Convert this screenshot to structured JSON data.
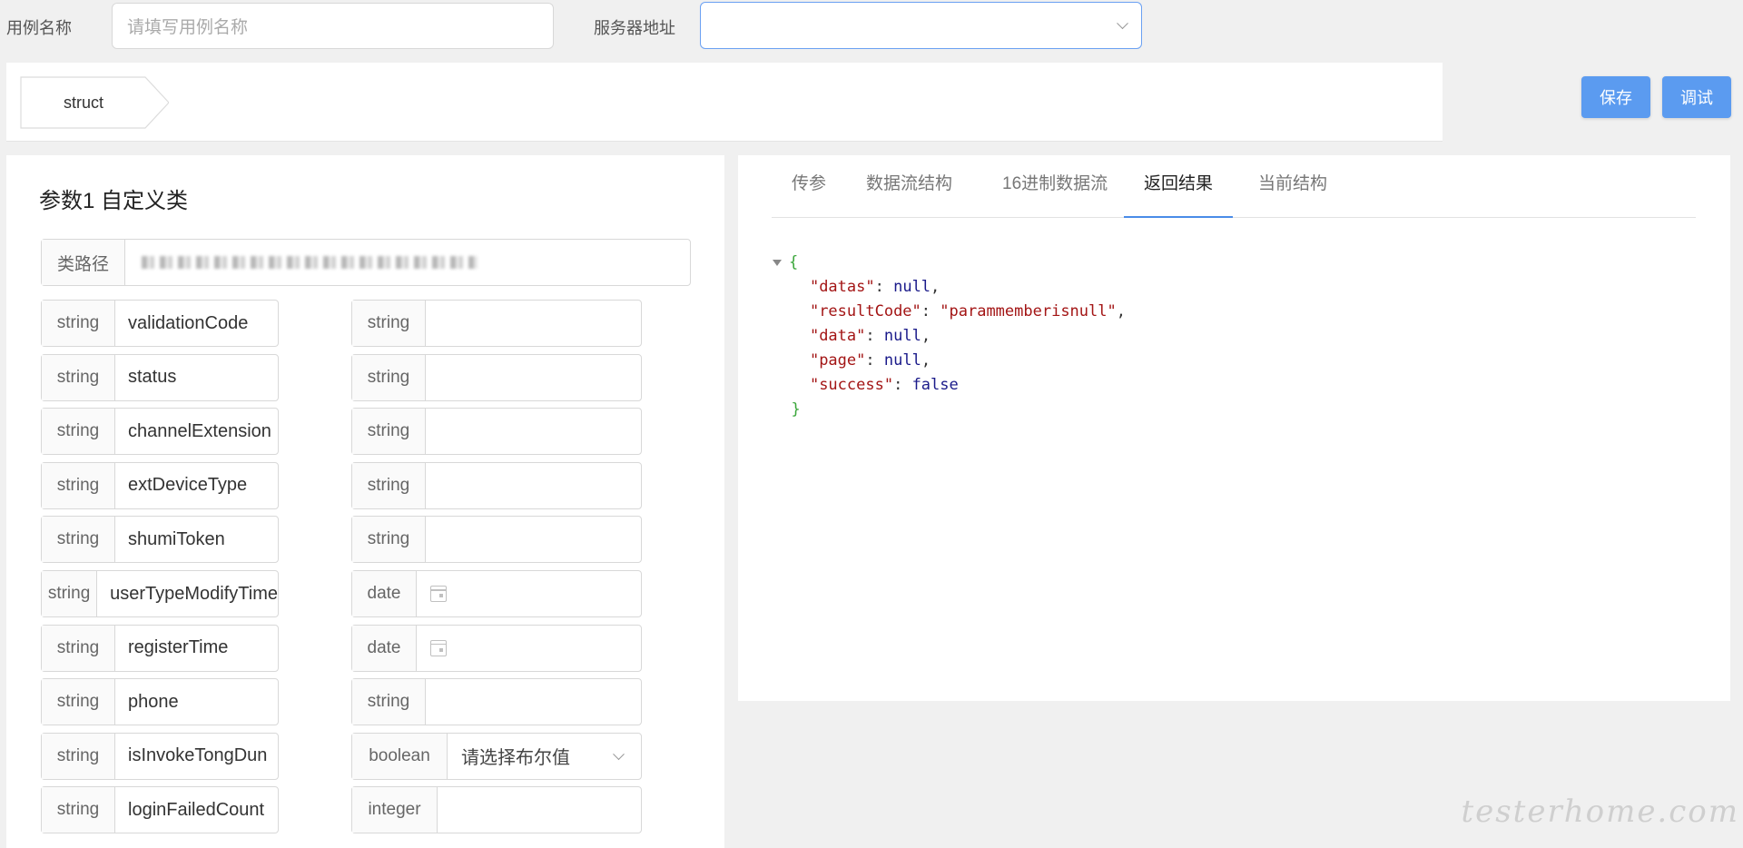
{
  "top": {
    "case_name_label": "用例名称",
    "case_name_placeholder": "请填写用例名称",
    "server_label": "服务器地址",
    "server_value": ""
  },
  "struct_tag": "struct",
  "buttons": {
    "save": "保存",
    "debug": "调试"
  },
  "left": {
    "title": "参数1 自定义类",
    "class_path_label": "类路径",
    "rows": [
      {
        "type": "string",
        "name": "validationCode",
        "val_type": "string",
        "kind": "text"
      },
      {
        "type": "string",
        "name": "status",
        "val_type": "string",
        "kind": "text"
      },
      {
        "type": "string",
        "name": "channelExtension",
        "val_type": "string",
        "kind": "text"
      },
      {
        "type": "string",
        "name": "extDeviceType",
        "val_type": "string",
        "kind": "text"
      },
      {
        "type": "string",
        "name": "shumiToken",
        "val_type": "string",
        "kind": "text"
      },
      {
        "type": "string",
        "name": "userTypeModifyTime",
        "val_type": "date",
        "kind": "date"
      },
      {
        "type": "string",
        "name": "registerTime",
        "val_type": "date",
        "kind": "date"
      },
      {
        "type": "string",
        "name": "phone",
        "val_type": "string",
        "kind": "text"
      },
      {
        "type": "string",
        "name": "isInvokeTongDun",
        "val_type": "boolean",
        "kind": "select",
        "placeholder": "请选择布尔值"
      },
      {
        "type": "string",
        "name": "loginFailedCount",
        "val_type": "integer",
        "kind": "text"
      }
    ]
  },
  "right": {
    "tabs": [
      "传参",
      "数据流结构",
      "16进制数据流",
      "返回结果",
      "当前结构"
    ],
    "active_tab": "返回结果",
    "json": [
      {
        "key": "datas",
        "value": "null",
        "vtype": "kw"
      },
      {
        "key": "resultCode",
        "value": "\"parammemberisnull\"",
        "vtype": "str"
      },
      {
        "key": "data",
        "value": "null",
        "vtype": "kw"
      },
      {
        "key": "page",
        "value": "null",
        "vtype": "kw"
      },
      {
        "key": "success",
        "value": "false",
        "vtype": "kw"
      }
    ]
  },
  "watermark": "testerhome.com"
}
